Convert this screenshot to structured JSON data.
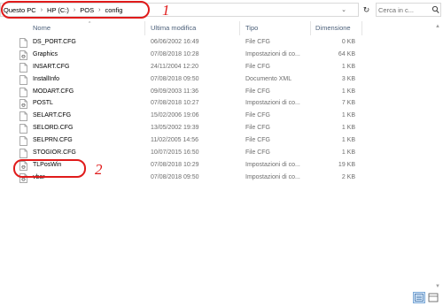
{
  "address_bar": {
    "breadcrumbs": [
      "Questo PC",
      "HP (C:)",
      "POS",
      "config"
    ],
    "separator": "›",
    "search_placeholder": "Cerca in c..."
  },
  "annotations": {
    "label_1": "1",
    "label_2": "2",
    "color": "#e01b1b"
  },
  "columns": {
    "name": "Nome",
    "modified": "Ultima modifica",
    "type": "Tipo",
    "size": "Dimensione"
  },
  "files": [
    {
      "name": "DS_PORT.CFG",
      "modified": "06/06/2002 16:49",
      "type": "File CFG",
      "size": "0 KB",
      "icon": "file-icon"
    },
    {
      "name": "Graphics",
      "modified": "07/08/2018 10:28",
      "type": "Impostazioni di co...",
      "size": "64 KB",
      "icon": "settings-file-icon"
    },
    {
      "name": "INSART.CFG",
      "modified": "24/11/2004 12:20",
      "type": "File CFG",
      "size": "1 KB",
      "icon": "file-icon"
    },
    {
      "name": "InstallInfo",
      "modified": "07/08/2018 09:50",
      "type": "Documento XML",
      "size": "3 KB",
      "icon": "file-icon"
    },
    {
      "name": "MODART.CFG",
      "modified": "09/09/2003 11:36",
      "type": "File CFG",
      "size": "1 KB",
      "icon": "file-icon"
    },
    {
      "name": "POSTL",
      "modified": "07/08/2018 10:27",
      "type": "Impostazioni di co...",
      "size": "7 KB",
      "icon": "settings-file-icon"
    },
    {
      "name": "SELART.CFG",
      "modified": "15/02/2006 19:06",
      "type": "File CFG",
      "size": "1 KB",
      "icon": "file-icon"
    },
    {
      "name": "SELORD.CFG",
      "modified": "13/05/2002 19:39",
      "type": "File CFG",
      "size": "1 KB",
      "icon": "file-icon"
    },
    {
      "name": "SELPRN.CFG",
      "modified": "11/02/2005 14:56",
      "type": "File CFG",
      "size": "1 KB",
      "icon": "file-icon"
    },
    {
      "name": "STOGIOR.CFG",
      "modified": "10/07/2015 16:50",
      "type": "File CFG",
      "size": "1 KB",
      "icon": "file-icon"
    },
    {
      "name": "TLPosWin",
      "modified": "07/08/2018 10:29",
      "type": "Impostazioni di co...",
      "size": "19 KB",
      "icon": "settings-file-icon"
    },
    {
      "name": "vbar",
      "modified": "07/08/2018 09:50",
      "type": "Impostazioni di co...",
      "size": "2 KB",
      "icon": "settings-file-icon"
    }
  ]
}
